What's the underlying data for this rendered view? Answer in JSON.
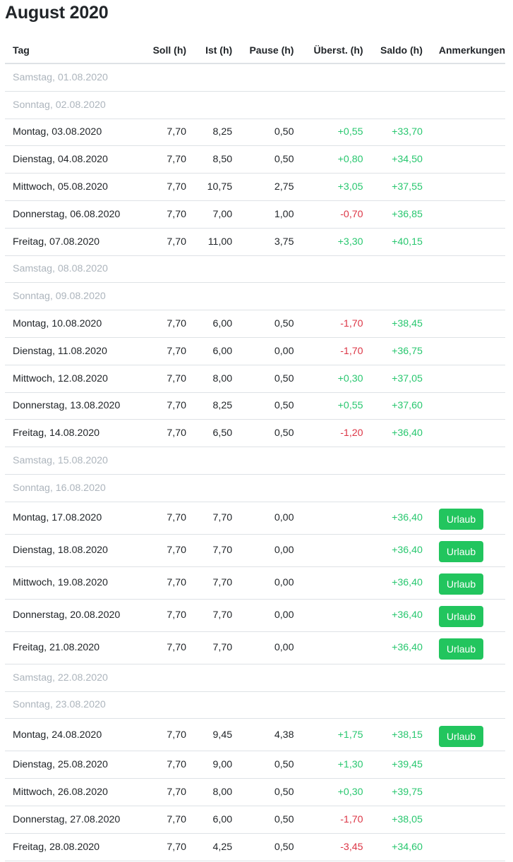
{
  "page": {
    "title": "August 2020"
  },
  "table": {
    "headers": {
      "tag": "Tag",
      "soll": "Soll (h)",
      "ist": "Ist (h)",
      "pause": "Pause (h)",
      "ueberst": "Überst. (h)",
      "saldo": "Saldo (h)",
      "anmerkungen": "Anmerkungen"
    },
    "rows": [
      {
        "tag": "Samstag, 01.08.2020",
        "weekend": true
      },
      {
        "tag": "Sonntag, 02.08.2020",
        "weekend": true
      },
      {
        "tag": "Montag, 03.08.2020",
        "soll": "7,70",
        "ist": "8,25",
        "pause": "0,50",
        "ueberst": "+0,55",
        "saldo": "+33,70"
      },
      {
        "tag": "Dienstag, 04.08.2020",
        "soll": "7,70",
        "ist": "8,50",
        "pause": "0,50",
        "ueberst": "+0,80",
        "saldo": "+34,50"
      },
      {
        "tag": "Mittwoch, 05.08.2020",
        "soll": "7,70",
        "ist": "10,75",
        "pause": "2,75",
        "ueberst": "+3,05",
        "saldo": "+37,55"
      },
      {
        "tag": "Donnerstag, 06.08.2020",
        "soll": "7,70",
        "ist": "7,00",
        "pause": "1,00",
        "ueberst": "-0,70",
        "saldo": "+36,85"
      },
      {
        "tag": "Freitag, 07.08.2020",
        "soll": "7,70",
        "ist": "11,00",
        "pause": "3,75",
        "ueberst": "+3,30",
        "saldo": "+40,15"
      },
      {
        "tag": "Samstag, 08.08.2020",
        "weekend": true
      },
      {
        "tag": "Sonntag, 09.08.2020",
        "weekend": true
      },
      {
        "tag": "Montag, 10.08.2020",
        "soll": "7,70",
        "ist": "6,00",
        "pause": "0,50",
        "ueberst": "-1,70",
        "saldo": "+38,45"
      },
      {
        "tag": "Dienstag, 11.08.2020",
        "soll": "7,70",
        "ist": "6,00",
        "pause": "0,00",
        "ueberst": "-1,70",
        "saldo": "+36,75"
      },
      {
        "tag": "Mittwoch, 12.08.2020",
        "soll": "7,70",
        "ist": "8,00",
        "pause": "0,50",
        "ueberst": "+0,30",
        "saldo": "+37,05"
      },
      {
        "tag": "Donnerstag, 13.08.2020",
        "soll": "7,70",
        "ist": "8,25",
        "pause": "0,50",
        "ueberst": "+0,55",
        "saldo": "+37,60"
      },
      {
        "tag": "Freitag, 14.08.2020",
        "soll": "7,70",
        "ist": "6,50",
        "pause": "0,50",
        "ueberst": "-1,20",
        "saldo": "+36,40"
      },
      {
        "tag": "Samstag, 15.08.2020",
        "weekend": true
      },
      {
        "tag": "Sonntag, 16.08.2020",
        "weekend": true
      },
      {
        "tag": "Montag, 17.08.2020",
        "soll": "7,70",
        "ist": "7,70",
        "pause": "0,00",
        "ueberst": "",
        "saldo": "+36,40",
        "note": "Urlaub"
      },
      {
        "tag": "Dienstag, 18.08.2020",
        "soll": "7,70",
        "ist": "7,70",
        "pause": "0,00",
        "ueberst": "",
        "saldo": "+36,40",
        "note": "Urlaub"
      },
      {
        "tag": "Mittwoch, 19.08.2020",
        "soll": "7,70",
        "ist": "7,70",
        "pause": "0,00",
        "ueberst": "",
        "saldo": "+36,40",
        "note": "Urlaub"
      },
      {
        "tag": "Donnerstag, 20.08.2020",
        "soll": "7,70",
        "ist": "7,70",
        "pause": "0,00",
        "ueberst": "",
        "saldo": "+36,40",
        "note": "Urlaub"
      },
      {
        "tag": "Freitag, 21.08.2020",
        "soll": "7,70",
        "ist": "7,70",
        "pause": "0,00",
        "ueberst": "",
        "saldo": "+36,40",
        "note": "Urlaub"
      },
      {
        "tag": "Samstag, 22.08.2020",
        "weekend": true
      },
      {
        "tag": "Sonntag, 23.08.2020",
        "weekend": true
      },
      {
        "tag": "Montag, 24.08.2020",
        "soll": "7,70",
        "ist": "9,45",
        "pause": "4,38",
        "ueberst": "+1,75",
        "saldo": "+38,15",
        "note": "Urlaub"
      },
      {
        "tag": "Dienstag, 25.08.2020",
        "soll": "7,70",
        "ist": "9,00",
        "pause": "0,50",
        "ueberst": "+1,30",
        "saldo": "+39,45"
      },
      {
        "tag": "Mittwoch, 26.08.2020",
        "soll": "7,70",
        "ist": "8,00",
        "pause": "0,50",
        "ueberst": "+0,30",
        "saldo": "+39,75"
      },
      {
        "tag": "Donnerstag, 27.08.2020",
        "soll": "7,70",
        "ist": "6,00",
        "pause": "0,50",
        "ueberst": "-1,70",
        "saldo": "+38,05"
      },
      {
        "tag": "Freitag, 28.08.2020",
        "soll": "7,70",
        "ist": "4,25",
        "pause": "0,50",
        "ueberst": "-3,45",
        "saldo": "+34,60"
      }
    ]
  },
  "colors": {
    "positive": "#28c76f",
    "negative": "#dc3545",
    "badge": "#22c55e",
    "weekend_text": "#adb5bd"
  }
}
